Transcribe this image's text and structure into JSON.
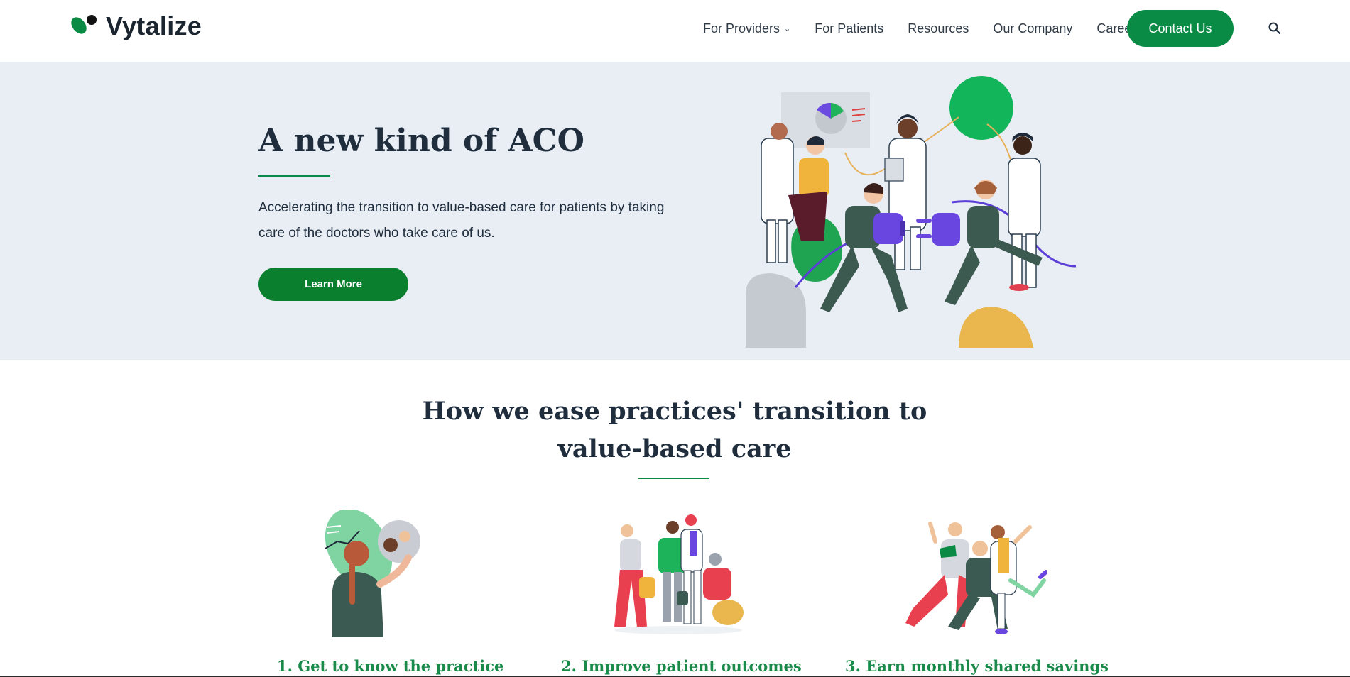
{
  "header": {
    "logo_text": "Vytalize",
    "nav": [
      {
        "label": "For Providers",
        "has_dropdown": true
      },
      {
        "label": "For Patients"
      },
      {
        "label": "Resources"
      },
      {
        "label": "Our Company"
      },
      {
        "label": "Careers"
      }
    ],
    "contact_label": "Contact Us",
    "search_icon": "search-icon"
  },
  "hero": {
    "title": "A new kind of ACO",
    "text": "Accelerating the transition to value-based care for patients by taking care of the doctors who take care of us.",
    "button_label": "Learn More"
  },
  "section": {
    "title_line1": "How we ease practices' transition to",
    "title_line2": "value-based care",
    "cards": [
      {
        "title": "1. Get to know the practice"
      },
      {
        "title": "2. Improve patient outcomes"
      },
      {
        "title": "3. Earn monthly shared savings"
      }
    ]
  },
  "colors": {
    "brand_green": "#098b46",
    "hero_bg": "#e9eef5",
    "heading": "#1f2d3d",
    "card_title": "#1a8a4a",
    "accent_purple": "#5b3fd6"
  }
}
